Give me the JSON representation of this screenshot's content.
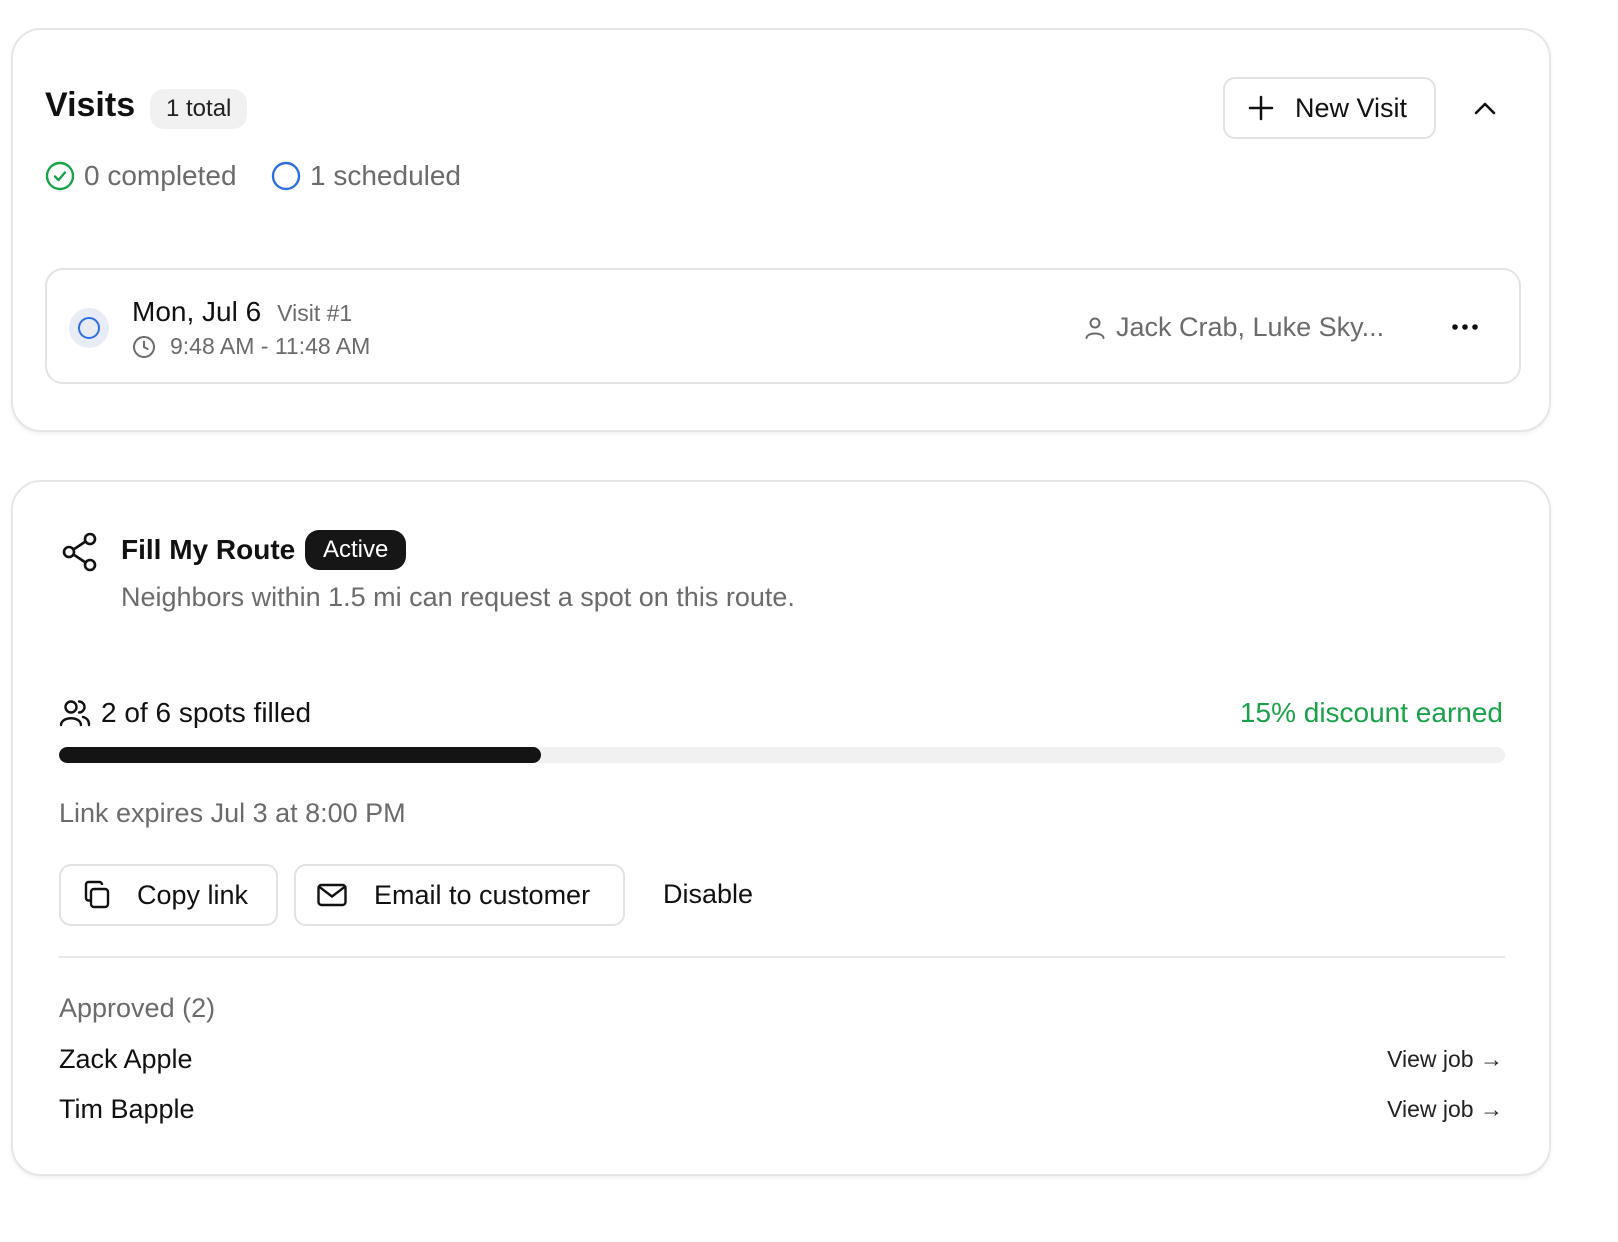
{
  "visits": {
    "title": "Visits",
    "total_badge": "1 total",
    "new_visit_label": "New Visit",
    "collapse_icon": "chevron-up-icon",
    "completed_stat": "0 completed",
    "scheduled_stat": "1 scheduled",
    "items": [
      {
        "date": "Mon, Jul 6",
        "visit_number": "Visit #1",
        "time_range": "9:48 AM - 11:48 AM",
        "assignees": "Jack Crab, Luke Sky...",
        "status": "scheduled"
      }
    ]
  },
  "route": {
    "title": "Fill My Route",
    "status_badge": "Active",
    "description": "Neighbors within 1.5 mi can request a spot on this route.",
    "spots_text": "2 of 6 spots filled",
    "spots_filled": 2,
    "spots_total": 6,
    "discount_text": "15% discount earned",
    "expires_text": "Link expires Jul 3 at 8:00 PM",
    "copy_link_label": "Copy link",
    "email_label": "Email to customer",
    "disable_label": "Disable",
    "approved_header": "Approved (2)",
    "approved": [
      {
        "name": "Zack Apple",
        "action": "View job →"
      },
      {
        "name": "Tim Bapple",
        "action": "View job →"
      }
    ]
  },
  "colors": {
    "accent_green": "#1aa24a",
    "scheduled_blue": "#2f6fe0",
    "dark": "#141414",
    "muted_text": "#6b6b6b"
  }
}
